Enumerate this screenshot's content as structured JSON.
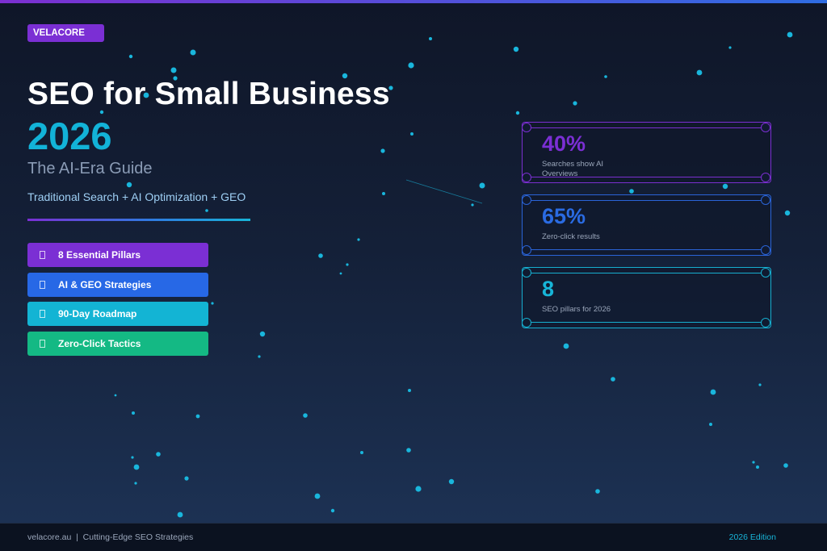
{
  "brand": {
    "name": "VELACORE"
  },
  "hero": {
    "title": "SEO for Small Business",
    "year": "2026",
    "subtitle": "The AI-Era Guide",
    "tagline": "Traditional Search + AI Optimization + GEO"
  },
  "features": [
    {
      "label": "8 Essential Pillars",
      "icon": "box-icon",
      "color": "#7b2fd4"
    },
    {
      "label": "AI & GEO Strategies",
      "icon": "box-icon",
      "color": "#2768e6"
    },
    {
      "label": "90-Day Roadmap",
      "icon": "box-icon",
      "color": "#13b4d4"
    },
    {
      "label": "Zero-Click Tactics",
      "icon": "box-icon",
      "color": "#14b984"
    }
  ],
  "stats": [
    {
      "value": "40%",
      "label": "Searches show AI Overviews",
      "color": "#7b2fd4"
    },
    {
      "value": "65%",
      "label": "Zero-click results",
      "color": "#2a6be2"
    },
    {
      "value": "8",
      "label": "SEO pillars for 2026",
      "color": "#17b5d8"
    }
  ],
  "footer": {
    "left": "velacore.au  |  Cutting-Edge SEO Strategies",
    "right": "2026 Edition"
  },
  "colors": {
    "accent_purple": "#7b2fd4",
    "accent_cyan": "#12b3d8",
    "background": "#142038"
  }
}
